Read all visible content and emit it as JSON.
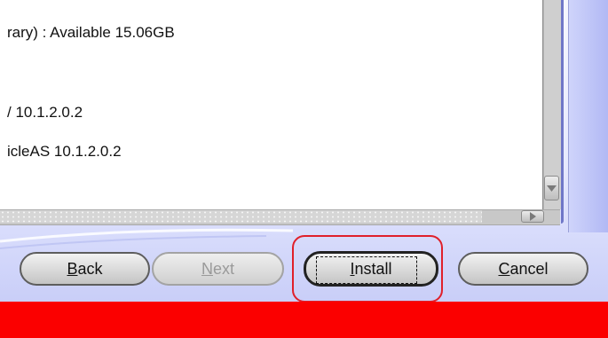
{
  "summary": {
    "lines": [
      "rary) : Available 15.06GB",
      "/ 10.1.2.0.2",
      "icleAS 10.1.2.0.2"
    ]
  },
  "scrollbars": {
    "vertical_down_icon": "triangle-down",
    "horizontal_right_icon": "triangle-right"
  },
  "buttons": {
    "back": {
      "pre": "",
      "mnemonic": "B",
      "post": "ack",
      "enabled": true
    },
    "next": {
      "pre": "",
      "mnemonic": "N",
      "post": "ext",
      "enabled": false
    },
    "install": {
      "pre": "",
      "mnemonic": "I",
      "post": "nstall",
      "enabled": true,
      "default": true
    },
    "cancel": {
      "pre": "",
      "mnemonic": "C",
      "post": "ancel",
      "enabled": true
    }
  },
  "colors": {
    "footer_bar": "#fb0000",
    "highlight_ring": "#e0202a",
    "panel_accent": "#6f77c8"
  }
}
